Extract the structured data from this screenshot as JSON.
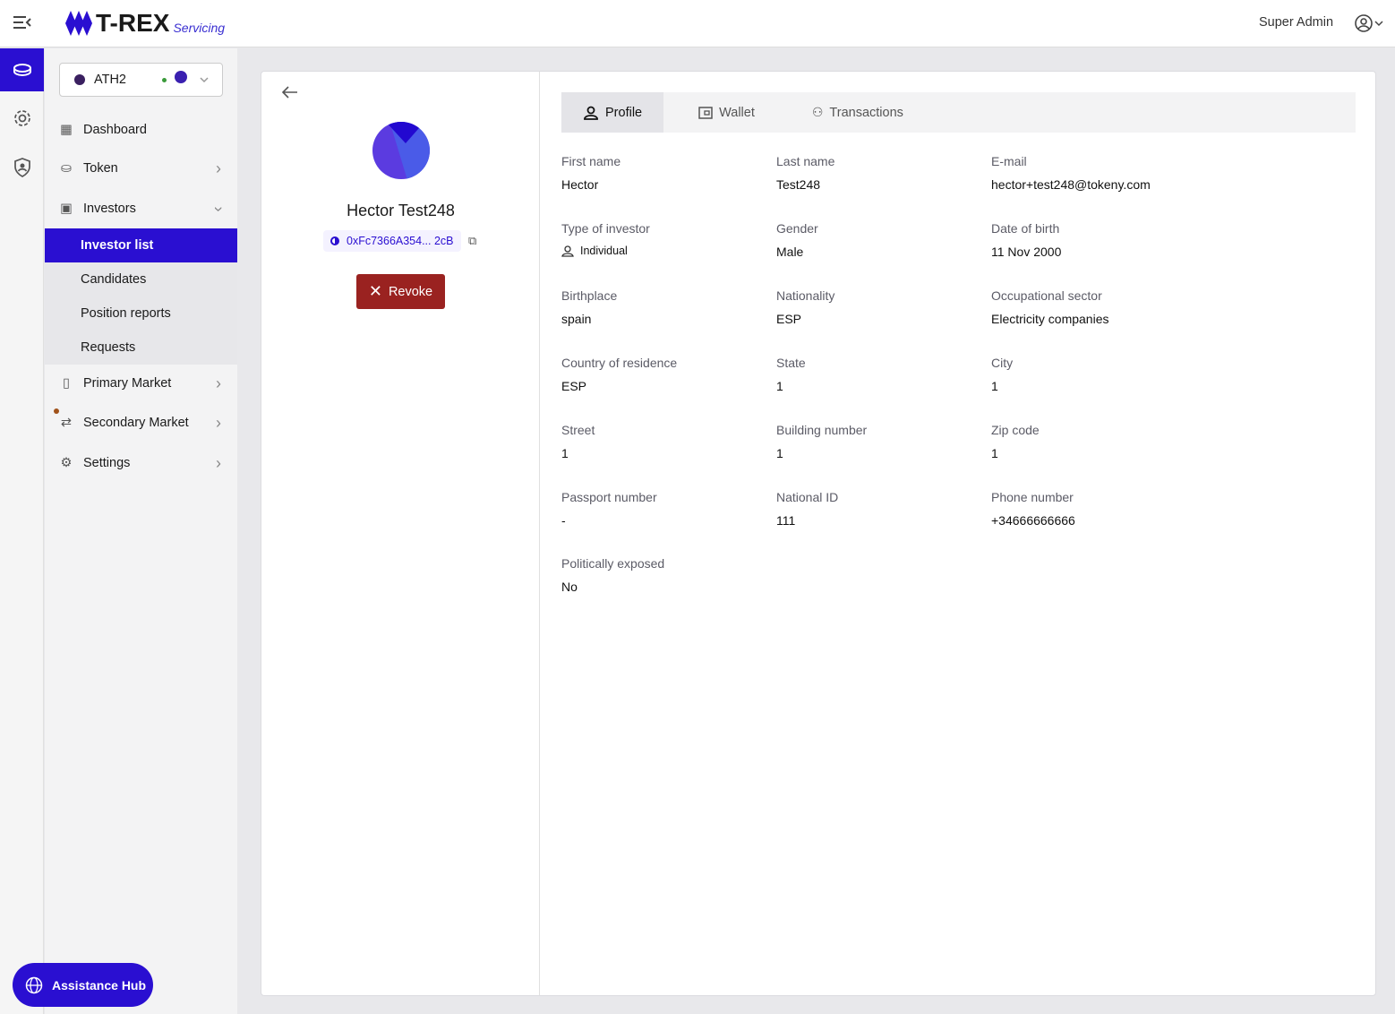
{
  "header": {
    "logo_main": "T-REX",
    "logo_sub": "Servicing",
    "user_name": "Super Admin"
  },
  "token_selector": {
    "name": "ATH2"
  },
  "sidebar": {
    "items": [
      {
        "label": "Dashboard"
      },
      {
        "label": "Token"
      },
      {
        "label": "Investors"
      },
      {
        "label": "Primary Market"
      },
      {
        "label": "Secondary Market"
      },
      {
        "label": "Settings"
      }
    ],
    "sub_items": [
      {
        "label": "Investor list"
      },
      {
        "label": "Candidates"
      },
      {
        "label": "Position reports"
      },
      {
        "label": "Requests"
      }
    ]
  },
  "assistance": {
    "label": "Assistance Hub"
  },
  "profile": {
    "name": "Hector Test248",
    "address": "0xFc7366A354... 2cB",
    "revoke_label": "Revoke"
  },
  "tabs": [
    {
      "label": "Profile"
    },
    {
      "label": "Wallet"
    },
    {
      "label": "Transactions"
    }
  ],
  "fields": [
    {
      "label": "First name",
      "value": "Hector"
    },
    {
      "label": "Last name",
      "value": "Test248"
    },
    {
      "label": "E-mail",
      "value": "hector+test248@tokeny.com"
    },
    {
      "label": "Type of investor",
      "value": "Individual"
    },
    {
      "label": "Gender",
      "value": "Male"
    },
    {
      "label": "Date of birth",
      "value": "11 Nov 2000"
    },
    {
      "label": "Birthplace",
      "value": "spain"
    },
    {
      "label": "Nationality",
      "value": "ESP"
    },
    {
      "label": "Occupational sector",
      "value": "Electricity companies"
    },
    {
      "label": "Country of residence",
      "value": "ESP"
    },
    {
      "label": "State",
      "value": "1"
    },
    {
      "label": "City",
      "value": "1"
    },
    {
      "label": "Street",
      "value": "1"
    },
    {
      "label": "Building number",
      "value": "1"
    },
    {
      "label": "Zip code",
      "value": "1"
    },
    {
      "label": "Passport number",
      "value": "-"
    },
    {
      "label": "National ID",
      "value": "111"
    },
    {
      "label": "Phone number",
      "value": "+34666666666"
    },
    {
      "label": "Politically exposed",
      "value": "No"
    }
  ]
}
